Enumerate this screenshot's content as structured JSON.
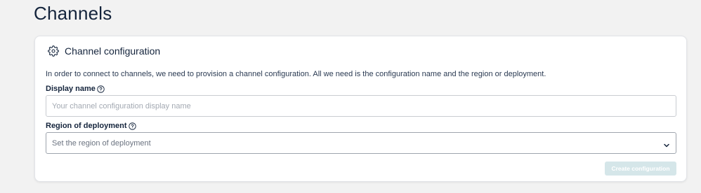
{
  "page": {
    "title": "Channels"
  },
  "card": {
    "title": "Channel configuration",
    "header_icon": "gear-icon",
    "description": "In order to connect to channels, we need to provision a channel configuration. All we need is the configuration name and the region or deployment.",
    "display_name": {
      "label": "Display name",
      "help_icon": "help-circle-icon",
      "value": "",
      "placeholder": "Your channel configuration display name"
    },
    "region": {
      "label": "Region of deployment",
      "help_icon": "help-circle-icon",
      "selected": "Set the region of deployment",
      "dropdown_icon": "chevron-down-icon"
    },
    "create_button": {
      "label": "Create configuration",
      "state": "disabled"
    }
  },
  "colors": {
    "background": "#f2f2f2",
    "card": "#ffffff",
    "text_primary": "#14243c",
    "button_disabled": "#d5e6e9"
  }
}
